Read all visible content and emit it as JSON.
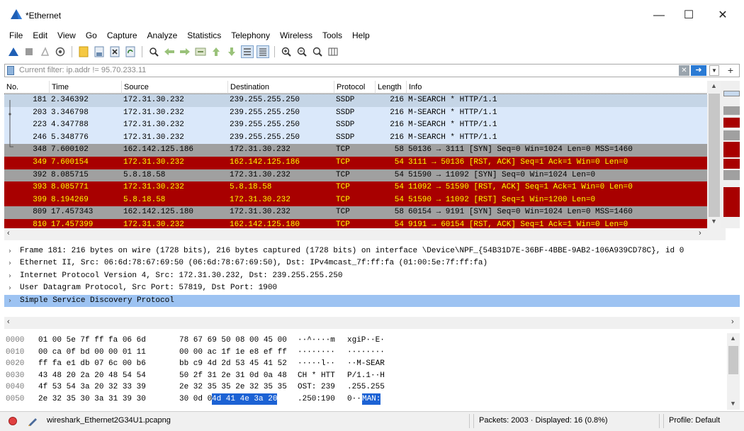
{
  "window": {
    "title": "*Ethernet",
    "controls": [
      "—",
      "☐",
      "✕"
    ]
  },
  "menu": [
    "File",
    "Edit",
    "View",
    "Go",
    "Capture",
    "Analyze",
    "Statistics",
    "Telephony",
    "Wireless",
    "Tools",
    "Help"
  ],
  "toolbar_icons": [
    "shark-fin-start-icon",
    "stop-icon",
    "restart-icon",
    "options-icon",
    "open-file-icon",
    "save-file-icon",
    "close-file-icon",
    "reload-icon",
    "find-icon",
    "back-icon",
    "forward-icon",
    "goto-icon",
    "first-icon",
    "last-icon",
    "autoscroll-icon",
    "colorize-icon",
    "zoom-in-icon",
    "zoom-out-icon",
    "zoom-reset-icon",
    "resize-columns-icon"
  ],
  "filter": {
    "placeholder": "Current filter: ip.addr != 95.70.233.11"
  },
  "columns": [
    "No.",
    "Time",
    "Source",
    "Destination",
    "Protocol",
    "Length",
    "Info"
  ],
  "colors": {
    "ssdp_bg": "#dae8fa",
    "selected_bg": "#c5d5e6",
    "tcp_gray_bg": "#a0a0a0",
    "tcp_red_bg": "#a80000",
    "tcp_red_fg": "#ffff00",
    "detail_selected_bg": "#9dc3f2",
    "bytes_highlight_bg": "#1c62d4"
  },
  "packets": [
    {
      "no": "181",
      "time": "2.346392",
      "src": "172.31.30.232",
      "dst": "239.255.255.250",
      "proto": "SSDP",
      "len": "216",
      "info": "M-SEARCH * HTTP/1.1",
      "style": "selected"
    },
    {
      "no": "203",
      "time": "3.346798",
      "src": "172.31.30.232",
      "dst": "239.255.255.250",
      "proto": "SSDP",
      "len": "216",
      "info": "M-SEARCH * HTTP/1.1",
      "style": "ssdp"
    },
    {
      "no": "223",
      "time": "4.347788",
      "src": "172.31.30.232",
      "dst": "239.255.255.250",
      "proto": "SSDP",
      "len": "216",
      "info": "M-SEARCH * HTTP/1.1",
      "style": "ssdp"
    },
    {
      "no": "246",
      "time": "5.348776",
      "src": "172.31.30.232",
      "dst": "239.255.255.250",
      "proto": "SSDP",
      "len": "216",
      "info": "M-SEARCH * HTTP/1.1",
      "style": "ssdp"
    },
    {
      "no": "348",
      "time": "7.600102",
      "src": "162.142.125.186",
      "dst": "172.31.30.232",
      "proto": "TCP",
      "len": "58",
      "info": "50136 → 3111 [SYN] Seq=0 Win=1024 Len=0 MSS=1460",
      "style": "gray"
    },
    {
      "no": "349",
      "time": "7.600154",
      "src": "172.31.30.232",
      "dst": "162.142.125.186",
      "proto": "TCP",
      "len": "54",
      "info": "3111 → 50136 [RST, ACK] Seq=1 Ack=1 Win=0 Len=0",
      "style": "red"
    },
    {
      "no": "392",
      "time": "8.085715",
      "src": "5.8.18.58",
      "dst": "172.31.30.232",
      "proto": "TCP",
      "len": "54",
      "info": "51590 → 11092 [SYN] Seq=0 Win=1024 Len=0",
      "style": "gray"
    },
    {
      "no": "393",
      "time": "8.085771",
      "src": "172.31.30.232",
      "dst": "5.8.18.58",
      "proto": "TCP",
      "len": "54",
      "info": "11092 → 51590 [RST, ACK] Seq=1 Ack=1 Win=0 Len=0",
      "style": "red"
    },
    {
      "no": "399",
      "time": "8.194269",
      "src": "5.8.18.58",
      "dst": "172.31.30.232",
      "proto": "TCP",
      "len": "54",
      "info": "51590 → 11092 [RST] Seq=1 Win=1200 Len=0",
      "style": "red"
    },
    {
      "no": "809",
      "time": "17.457343",
      "src": "162.142.125.180",
      "dst": "172.31.30.232",
      "proto": "TCP",
      "len": "58",
      "info": "60154 → 9191 [SYN] Seq=0 Win=1024 Len=0 MSS=1460",
      "style": "gray"
    },
    {
      "no": "810",
      "time": "17.457399",
      "src": "172.31.30.232",
      "dst": "162.142.125.180",
      "proto": "TCP",
      "len": "54",
      "info": "9191 → 60154 [RST, ACK] Seq=1 Ack=1 Win=0 Len=0",
      "style": "red"
    }
  ],
  "details": [
    {
      "text": "Frame 181: 216 bytes on wire (1728 bits), 216 bytes captured (1728 bits) on interface \\Device\\NPF_{54B31D7E-36BF-4BBE-9AB2-106A939CD78C}, id 0",
      "selected": false
    },
    {
      "text": "Ethernet II, Src: 06:6d:78:67:69:50 (06:6d:78:67:69:50), Dst: IPv4mcast_7f:ff:fa (01:00:5e:7f:ff:fa)",
      "selected": false
    },
    {
      "text": "Internet Protocol Version 4, Src: 172.31.30.232, Dst: 239.255.255.250",
      "selected": false
    },
    {
      "text": "User Datagram Protocol, Src Port: 57819, Dst Port: 1900",
      "selected": false
    },
    {
      "text": "Simple Service Discovery Protocol",
      "selected": true
    }
  ],
  "bytes": [
    {
      "offset": "0000",
      "hex1": "01 00 5e 7f ff fa 06 6d",
      "hex2": "78 67 69 50 08 00 45 00",
      "ascii1": "··^····m",
      "ascii2": "xgiP··E·"
    },
    {
      "offset": "0010",
      "hex1": "00 ca 0f bd 00 00 01 11",
      "hex2": "00 00 ac 1f 1e e8 ef ff",
      "ascii1": "········",
      "ascii2": "········"
    },
    {
      "offset": "0020",
      "hex1": "ff fa e1 db 07 6c 00 b6",
      "hex2": "bb c9 4d 2d 53 45 41 52",
      "ascii1": "·····l··",
      "ascii2": "··M-SEAR"
    },
    {
      "offset": "0030",
      "hex1": "43 48 20 2a 20 48 54 54",
      "hex2": "50 2f 31 2e 31 0d 0a 48",
      "ascii1": "CH * HTT",
      "ascii2": "P/1.1··H"
    },
    {
      "offset": "0040",
      "hex1": "4f 53 54 3a 20 32 33 39",
      "hex2": "2e 32 35 35 2e 32 35 35",
      "ascii1": "OST: 239",
      "ascii2": ".255.255"
    },
    {
      "offset": "0050",
      "hex1": "2e 32 35 30 3a 31 39 30",
      "hex2_plain": "30 0d 0a ",
      "hex2_hl": "4d 41 4e 3a 20",
      "ascii1": ".250:190",
      "ascii2_plain": "0··",
      "ascii2_hl": "MAN:"
    }
  ],
  "status": {
    "file": "wireshark_Ethernet2G34U1.pcapng",
    "packets": "Packets: 2003 · Displayed: 16 (0.8%)",
    "profile": "Profile: Default"
  }
}
